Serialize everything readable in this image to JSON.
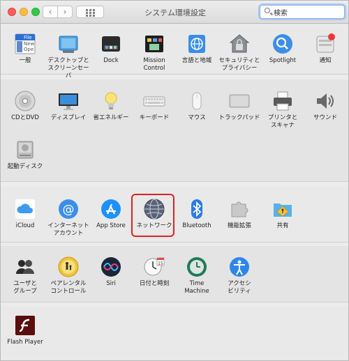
{
  "window": {
    "title": "システム環境設定"
  },
  "toolbar": {
    "back": "‹",
    "forward": "›"
  },
  "search": {
    "value": "検索"
  },
  "sections": [
    {
      "items": [
        {
          "id": "general",
          "label": "一般",
          "icon_text": [
            "File",
            "New",
            "Ope"
          ]
        },
        {
          "id": "desktop",
          "label": "デスクトップと\nスクリーンセーバ"
        },
        {
          "id": "dock",
          "label": "Dock"
        },
        {
          "id": "mission",
          "label": "Mission\nControl"
        },
        {
          "id": "language",
          "label": "言語と地域"
        },
        {
          "id": "security",
          "label": "セキュリティと\nプライバシー"
        },
        {
          "id": "spotlight",
          "label": "Spotlight"
        },
        {
          "id": "notifications",
          "label": "通知"
        }
      ]
    },
    {
      "items": [
        {
          "id": "cddvd",
          "label": "CDとDVD"
        },
        {
          "id": "display",
          "label": "ディスプレイ"
        },
        {
          "id": "energy",
          "label": "省エネルギー"
        },
        {
          "id": "keyboard",
          "label": "キーボード"
        },
        {
          "id": "mouse",
          "label": "マウス"
        },
        {
          "id": "trackpad",
          "label": "トラックパッド"
        },
        {
          "id": "printers",
          "label": "プリンタと\nスキャナ"
        },
        {
          "id": "sound",
          "label": "サウンド"
        },
        {
          "id": "startup",
          "label": "起動ディスク"
        }
      ]
    },
    {
      "items": [
        {
          "id": "icloud",
          "label": "iCloud"
        },
        {
          "id": "internet",
          "label": "インターネット\nアカウント"
        },
        {
          "id": "appstore",
          "label": "App Store"
        },
        {
          "id": "network",
          "label": "ネットワーク"
        },
        {
          "id": "bluetooth",
          "label": "Bluetooth"
        },
        {
          "id": "extensions",
          "label": "機能拡張"
        },
        {
          "id": "sharing",
          "label": "共有"
        }
      ]
    },
    {
      "items": [
        {
          "id": "users",
          "label": "ユーザと\nグループ"
        },
        {
          "id": "parental",
          "label": "ペアレンタル\nコントロール"
        },
        {
          "id": "siri",
          "label": "Siri"
        },
        {
          "id": "datetime",
          "label": "日付と時刻",
          "icon_text": "15"
        },
        {
          "id": "timemachine",
          "label": "Time\nMachine"
        },
        {
          "id": "accessibility",
          "label": "アクセシ\nビリティ"
        }
      ]
    },
    {
      "items": [
        {
          "id": "flash",
          "label": "Flash Player"
        }
      ]
    }
  ]
}
